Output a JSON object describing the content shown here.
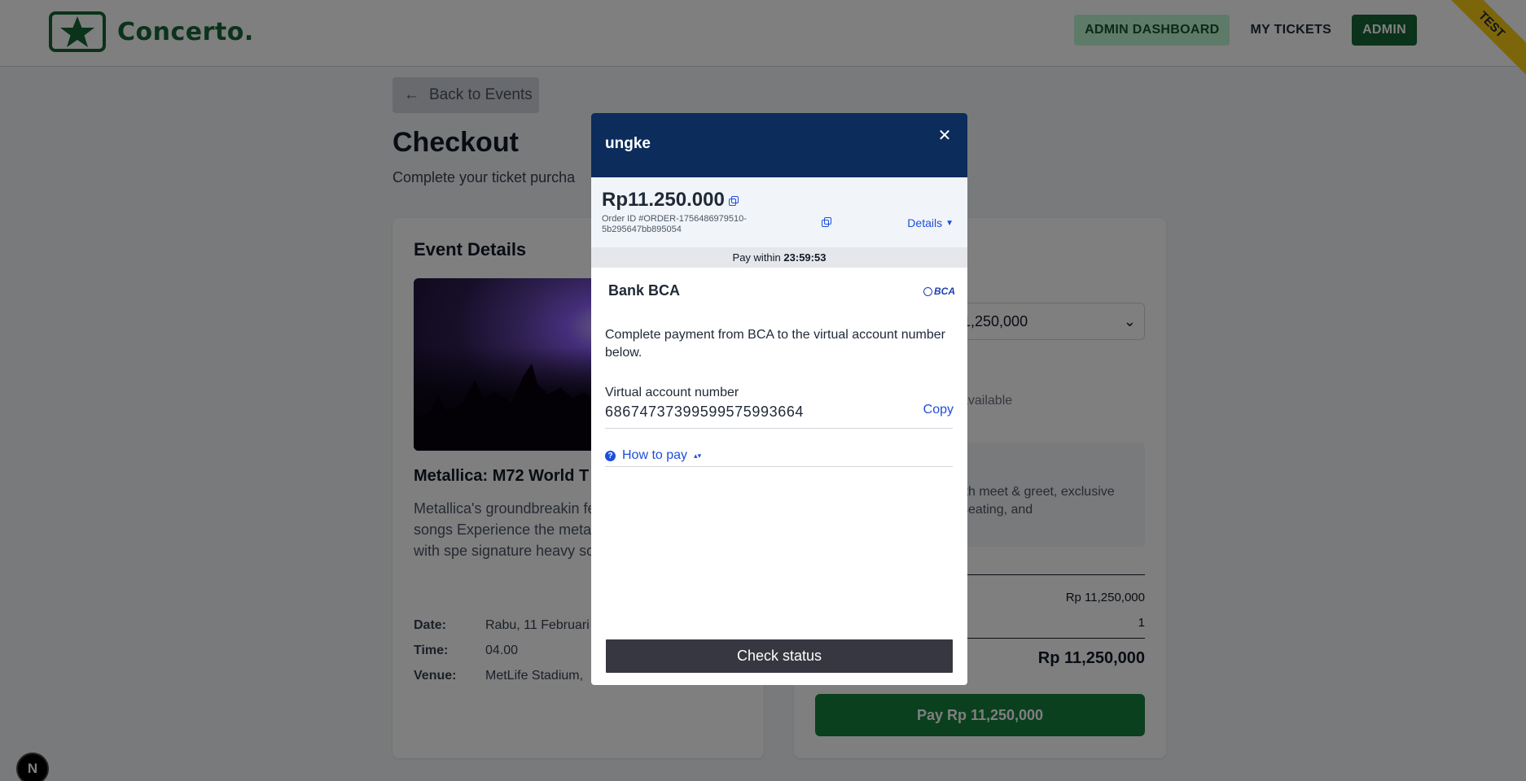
{
  "header": {
    "logo_text": "Concerto.",
    "nav": {
      "admin_dashboard": "ADMIN DASHBOARD",
      "my_tickets": "MY TICKETS",
      "admin": "ADMIN"
    },
    "ribbon": "TEST"
  },
  "page": {
    "back_label": "Back to Events",
    "title": "Checkout",
    "subtitle": "Complete your ticket purcha"
  },
  "event": {
    "section_title": "Event Details",
    "name": "Metallica: M72 World T",
    "description": "Metallica's groundbreakin featuring no repeat songs Experience the metal lege cuts and classics with spe signature heavy sound.",
    "details": [
      {
        "label": "Date:",
        "value": "Rabu, 11 Februari"
      },
      {
        "label": "Time:",
        "value": "04.00"
      },
      {
        "label": "Venue:",
        "value": "MetLife Stadium,"
      }
    ]
  },
  "order": {
    "select_value": "1,250,000",
    "availability": "available",
    "tier_description": "ith meet & greet, exclusive seating, and",
    "subtotal": "Rp 11,250,000",
    "quantity": "1",
    "total": "Rp 11,250,000",
    "pay_label": "Pay Rp 11,250,000"
  },
  "modal": {
    "merchant": "ungke",
    "close": "✕",
    "amount": "Rp11.250.000",
    "order_id": "Order ID #ORDER-1756486979510-5b295647bb895054",
    "details_label": "Details",
    "timer_label": "Pay within",
    "timer_value": "23:59:53",
    "bank_name": "Bank BCA",
    "bank_logo": "BCA",
    "instruction": "Complete payment from BCA to the virtual account number below.",
    "va_label": "Virtual account number",
    "va_number": "686747373995995759936​64",
    "copy_label": "Copy",
    "how_to_pay": "How to pay",
    "check_status": "Check status"
  },
  "next_badge": "N",
  "colors": {
    "brand_green": "#166534",
    "pay_green": "#15803d",
    "modal_header": "#0c2c5c",
    "link_blue": "#1d4ed8"
  }
}
